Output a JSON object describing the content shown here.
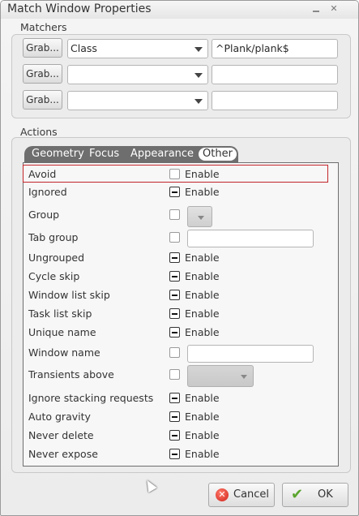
{
  "window": {
    "title": "Match Window Properties",
    "minimize_glyph": "",
    "close_glyph": "✕"
  },
  "matchers": {
    "label": "Matchers",
    "rows": [
      {
        "grab": "Grab...",
        "property": "Class",
        "value": "^Plank/plank$"
      },
      {
        "grab": "Grab...",
        "property": "",
        "value": ""
      },
      {
        "grab": "Grab...",
        "property": "",
        "value": ""
      }
    ]
  },
  "actions": {
    "label": "Actions",
    "tabs": [
      "Geometry",
      "Focus",
      "Appearance",
      "Other"
    ],
    "active_tab": "Other",
    "enable_label": "Enable",
    "rows": [
      {
        "label": "Avoid",
        "control": "checkbox",
        "state": "unchecked",
        "selected": true
      },
      {
        "label": "Ignored",
        "control": "checkbox",
        "state": "mixed"
      },
      {
        "label": "Group",
        "control": "checkbox+button",
        "state": "unchecked"
      },
      {
        "label": "Tab group",
        "control": "checkbox+input",
        "state": "unchecked"
      },
      {
        "label": "Ungrouped",
        "control": "checkbox",
        "state": "mixed"
      },
      {
        "label": "Cycle skip",
        "control": "checkbox",
        "state": "mixed"
      },
      {
        "label": "Window list skip",
        "control": "checkbox",
        "state": "mixed"
      },
      {
        "label": "Task list skip",
        "control": "checkbox",
        "state": "mixed"
      },
      {
        "label": "Unique name",
        "control": "checkbox",
        "state": "mixed"
      },
      {
        "label": "Window name",
        "control": "checkbox+input",
        "state": "unchecked"
      },
      {
        "label": "Transients above",
        "control": "checkbox+combo",
        "state": "unchecked"
      },
      {
        "label": "Ignore stacking requests",
        "control": "checkbox",
        "state": "mixed"
      },
      {
        "label": "Auto gravity",
        "control": "checkbox",
        "state": "mixed"
      },
      {
        "label": "Never delete",
        "control": "checkbox",
        "state": "mixed"
      },
      {
        "label": "Never expose",
        "control": "checkbox",
        "state": "mixed"
      }
    ]
  },
  "buttons": {
    "cancel": "Cancel",
    "ok": "OK"
  },
  "colors": {
    "selection_border": "#c2262a",
    "tab_bar": "#6e6e6e",
    "ok_icon": "#5aa52e",
    "cancel_icon": "#d0231b"
  }
}
